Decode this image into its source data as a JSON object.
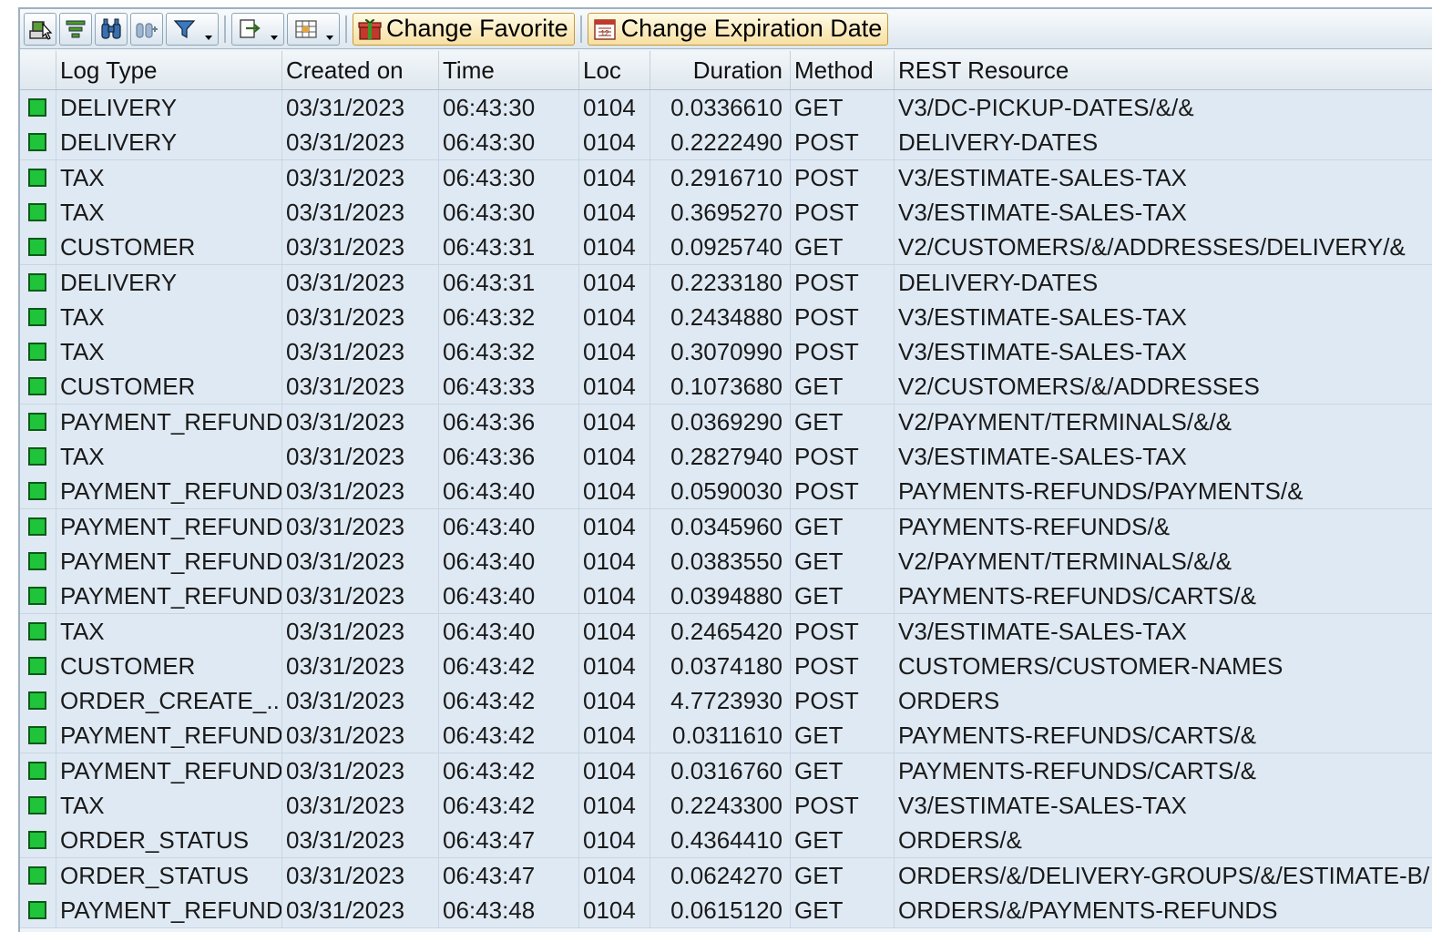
{
  "toolbar": {
    "buttons": [
      {
        "name": "details-button",
        "icon": "details-icon"
      },
      {
        "name": "sort-button",
        "icon": "sort-icon"
      },
      {
        "name": "find-button",
        "icon": "binoculars-icon"
      },
      {
        "name": "find-next-button",
        "icon": "binoculars-next-icon"
      },
      {
        "name": "filter-button",
        "icon": "filter-icon"
      },
      {
        "name": "export-button",
        "icon": "export-icon"
      },
      {
        "name": "layout-button",
        "icon": "layout-icon"
      }
    ],
    "change_favorite_label": "Change Favorite",
    "change_expiration_label": "Change Expiration Date"
  },
  "columns": [
    "Log Type",
    "Created on",
    "Time",
    "Loc",
    "Duration",
    "Method",
    "REST Resource"
  ],
  "status_color": "#1fc43a",
  "rows": [
    [
      "DELIVERY",
      "03/31/2023",
      "06:43:30",
      "0104",
      "0.0336610",
      "GET",
      "V3/DC-PICKUP-DATES/&/&"
    ],
    [
      "DELIVERY",
      "03/31/2023",
      "06:43:30",
      "0104",
      "0.2222490",
      "POST",
      "DELIVERY-DATES"
    ],
    [
      "TAX",
      "03/31/2023",
      "06:43:30",
      "0104",
      "0.2916710",
      "POST",
      "V3/ESTIMATE-SALES-TAX"
    ],
    [
      "TAX",
      "03/31/2023",
      "06:43:30",
      "0104",
      "0.3695270",
      "POST",
      "V3/ESTIMATE-SALES-TAX"
    ],
    [
      "CUSTOMER",
      "03/31/2023",
      "06:43:31",
      "0104",
      "0.0925740",
      "GET",
      "V2/CUSTOMERS/&/ADDRESSES/DELIVERY/&"
    ],
    [
      "DELIVERY",
      "03/31/2023",
      "06:43:31",
      "0104",
      "0.2233180",
      "POST",
      "DELIVERY-DATES"
    ],
    [
      "TAX",
      "03/31/2023",
      "06:43:32",
      "0104",
      "0.2434880",
      "POST",
      "V3/ESTIMATE-SALES-TAX"
    ],
    [
      "TAX",
      "03/31/2023",
      "06:43:32",
      "0104",
      "0.3070990",
      "POST",
      "V3/ESTIMATE-SALES-TAX"
    ],
    [
      "CUSTOMER",
      "03/31/2023",
      "06:43:33",
      "0104",
      "0.1073680",
      "GET",
      "V2/CUSTOMERS/&/ADDRESSES"
    ],
    [
      "PAYMENT_REFUND",
      "03/31/2023",
      "06:43:36",
      "0104",
      "0.0369290",
      "GET",
      "V2/PAYMENT/TERMINALS/&/&"
    ],
    [
      "TAX",
      "03/31/2023",
      "06:43:36",
      "0104",
      "0.2827940",
      "POST",
      "V3/ESTIMATE-SALES-TAX"
    ],
    [
      "PAYMENT_REFUND",
      "03/31/2023",
      "06:43:40",
      "0104",
      "0.0590030",
      "POST",
      "PAYMENTS-REFUNDS/PAYMENTS/&"
    ],
    [
      "PAYMENT_REFUND",
      "03/31/2023",
      "06:43:40",
      "0104",
      "0.0345960",
      "GET",
      "PAYMENTS-REFUNDS/&"
    ],
    [
      "PAYMENT_REFUND",
      "03/31/2023",
      "06:43:40",
      "0104",
      "0.0383550",
      "GET",
      "V2/PAYMENT/TERMINALS/&/&"
    ],
    [
      "PAYMENT_REFUND",
      "03/31/2023",
      "06:43:40",
      "0104",
      "0.0394880",
      "GET",
      "PAYMENTS-REFUNDS/CARTS/&"
    ],
    [
      "TAX",
      "03/31/2023",
      "06:43:40",
      "0104",
      "0.2465420",
      "POST",
      "V3/ESTIMATE-SALES-TAX"
    ],
    [
      "CUSTOMER",
      "03/31/2023",
      "06:43:42",
      "0104",
      "0.0374180",
      "POST",
      "CUSTOMERS/CUSTOMER-NAMES"
    ],
    [
      "ORDER_CREATE_...",
      "03/31/2023",
      "06:43:42",
      "0104",
      "4.7723930",
      "POST",
      "ORDERS"
    ],
    [
      "PAYMENT_REFUND",
      "03/31/2023",
      "06:43:42",
      "0104",
      "0.0311610",
      "GET",
      "PAYMENTS-REFUNDS/CARTS/&"
    ],
    [
      "PAYMENT_REFUND",
      "03/31/2023",
      "06:43:42",
      "0104",
      "0.0316760",
      "GET",
      "PAYMENTS-REFUNDS/CARTS/&"
    ],
    [
      "TAX",
      "03/31/2023",
      "06:43:42",
      "0104",
      "0.2243300",
      "POST",
      "V3/ESTIMATE-SALES-TAX"
    ],
    [
      "ORDER_STATUS",
      "03/31/2023",
      "06:43:47",
      "0104",
      "0.4364410",
      "GET",
      "ORDERS/&"
    ],
    [
      "ORDER_STATUS",
      "03/31/2023",
      "06:43:47",
      "0104",
      "0.0624270",
      "GET",
      "ORDERS/&/DELIVERY-GROUPS/&/ESTIMATE-B/"
    ],
    [
      "PAYMENT_REFUND",
      "03/31/2023",
      "06:43:48",
      "0104",
      "0.0615120",
      "GET",
      "ORDERS/&/PAYMENTS-REFUNDS"
    ]
  ]
}
